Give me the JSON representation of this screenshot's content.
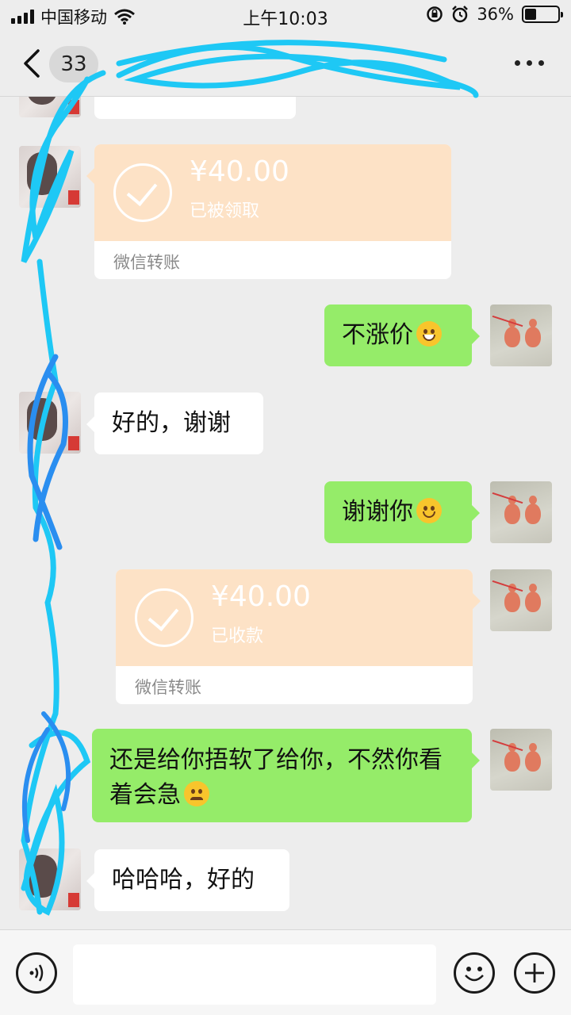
{
  "status_bar": {
    "carrier": "中国移动",
    "time": "上午10:03",
    "battery_pct": "36%",
    "battery_level": 0.36,
    "icons": [
      "signal-icon",
      "wifi-icon",
      "orientation-lock-icon",
      "alarm-icon",
      "battery-icon"
    ]
  },
  "nav": {
    "back_icon": "chevron-left-icon",
    "unread_count": "33",
    "title": "",
    "more_icon": "more-dots-icon"
  },
  "messages": {
    "transfer1": {
      "amount": "¥40.00",
      "status": "已被领取",
      "footer": "微信转账"
    },
    "msg_no_price_rise": "不涨价",
    "msg_ok_thanks": "好的，谢谢",
    "msg_thank_you": "谢谢你",
    "transfer2": {
      "amount": "¥40.00",
      "status": "已收款",
      "footer": "微信转账"
    },
    "msg_long": "还是给你捂软了给你，不然你看着会急",
    "msg_hahaha": "哈哈哈，好的"
  },
  "input_bar": {
    "voice_icon": "voice-icon",
    "emoji_icon": "emoji-icon",
    "plus_icon": "plus-icon",
    "text_value": ""
  },
  "colors": {
    "chat_bg": "#ededed",
    "green_bubble": "#95ec69",
    "transfer_bg": "#fde2c6",
    "scribble": "#1ec8f5"
  }
}
